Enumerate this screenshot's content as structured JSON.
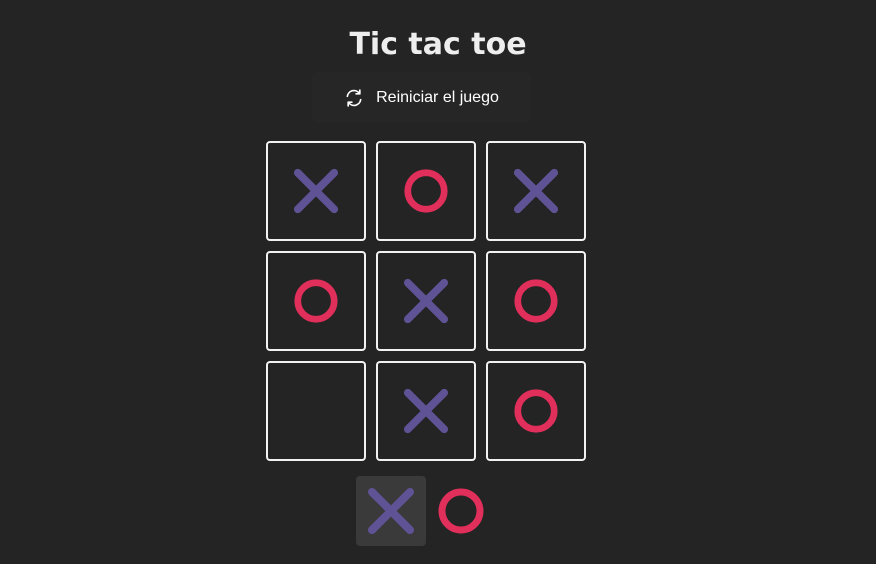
{
  "header": {
    "title": "Tic tac toe"
  },
  "reset_button": {
    "label": "Reiniciar el juego",
    "icon": "refresh-icon"
  },
  "board": {
    "cells": [
      "X",
      "O",
      "X",
      "O",
      "X",
      "O",
      "",
      "X",
      "O"
    ]
  },
  "turn_indicator": {
    "players": [
      "X",
      "O"
    ],
    "current": "X"
  },
  "colors": {
    "background": "#242424",
    "x_mark": "#5f5396",
    "o_mark": "#e02f5b",
    "cell_border": "#f2f2f2",
    "active_turn_bg": "#3a3a3a"
  }
}
